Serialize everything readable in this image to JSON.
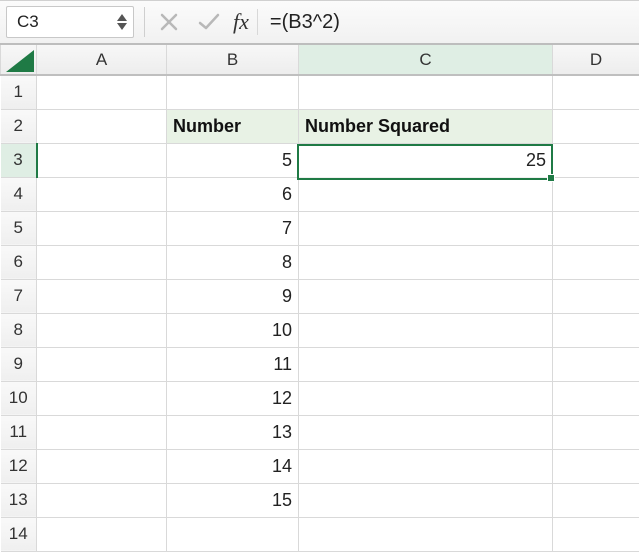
{
  "formulaBar": {
    "cellRef": "C3",
    "fxLabel": "fx",
    "formula": "=(B3^2)"
  },
  "columns": [
    "A",
    "B",
    "C",
    "D"
  ],
  "rows": [
    "1",
    "2",
    "3",
    "4",
    "5",
    "6",
    "7",
    "8",
    "9",
    "10",
    "11",
    "12",
    "13",
    "14"
  ],
  "headers": {
    "b2": "Number",
    "c2": "Number Squared"
  },
  "numbers": {
    "b3": "5",
    "b4": "6",
    "b5": "7",
    "b6": "8",
    "b7": "9",
    "b8": "10",
    "b9": "11",
    "b10": "12",
    "b11": "13",
    "b12": "14",
    "b13": "15"
  },
  "results": {
    "c3": "25"
  },
  "activeCell": "C3",
  "colors": {
    "selection": "#1f7a45",
    "headerFill": "#e8f2e5"
  }
}
